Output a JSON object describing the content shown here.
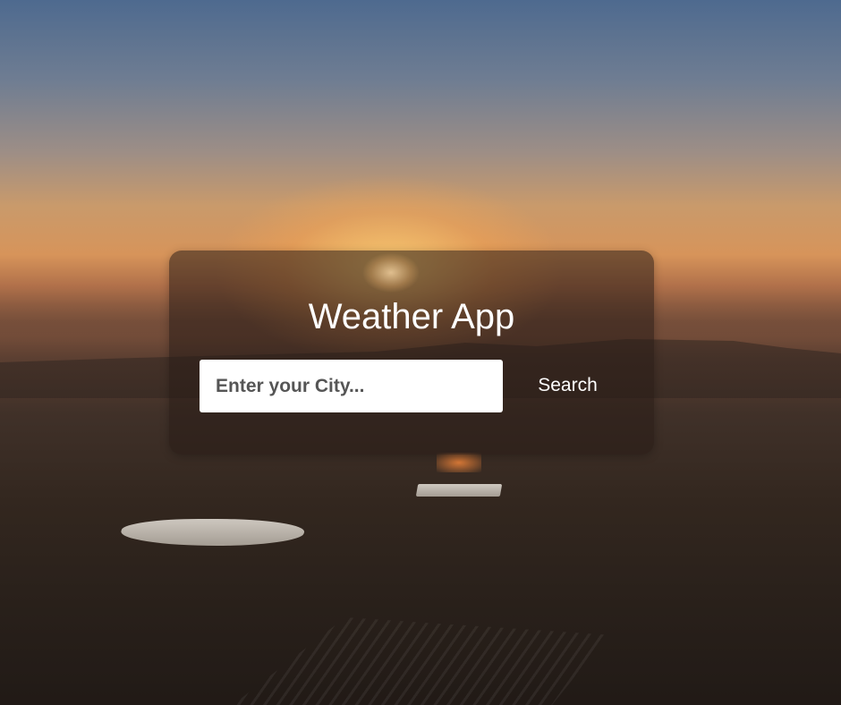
{
  "app": {
    "title": "Weather App"
  },
  "search": {
    "placeholder": "Enter your City...",
    "value": "",
    "button_label": "Search"
  },
  "colors": {
    "card_background": "rgba(40,28,22,0.55)",
    "title_text": "#ffffff",
    "input_background": "#ffffff"
  }
}
